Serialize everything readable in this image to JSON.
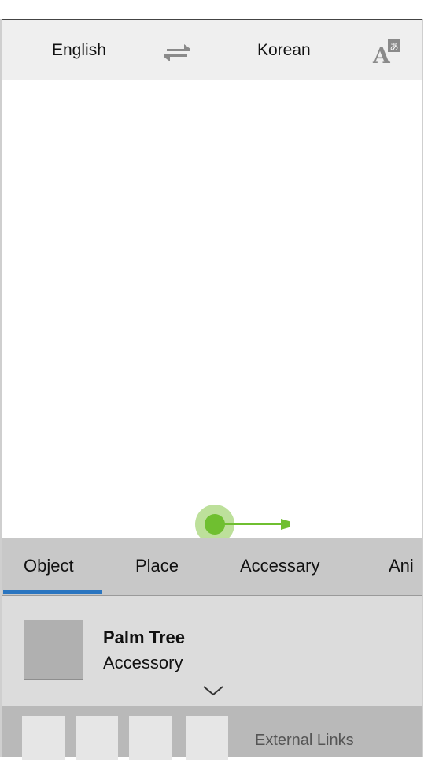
{
  "header": {
    "source_language": "English",
    "target_language": "Korean",
    "swap_icon": "swap-arrows-icon",
    "translate_icon": "translate-icon"
  },
  "canvas": {
    "drag_hint_icon": "swipe-right-icon",
    "accent_color": "#6fbf30"
  },
  "category_tabs": {
    "items": [
      {
        "label": "Object",
        "selected": true
      },
      {
        "label": "Place",
        "selected": false
      },
      {
        "label": "Accessary",
        "selected": false
      },
      {
        "label": "Ani",
        "selected": false
      }
    ],
    "indicator_color": "#2a75c0"
  },
  "selected_item": {
    "name": "Palm Tree",
    "category": "Accessory",
    "expand_icon": "chevron-down-icon"
  },
  "external_links": {
    "label": "External Links"
  }
}
